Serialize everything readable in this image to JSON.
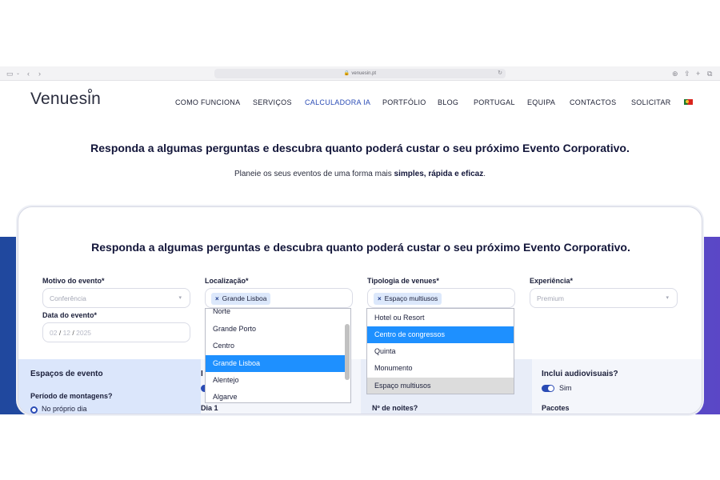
{
  "browser": {
    "url": "venuesin.pt"
  },
  "site": {
    "logo": "Venuesin",
    "nav": [
      {
        "label": "COMO FUNCIONA"
      },
      {
        "label": "SERVIÇOS"
      },
      {
        "label": "CALCULADORA IA"
      },
      {
        "label": "PORTFÓLIO"
      },
      {
        "label": "BLOG"
      },
      {
        "label": "PORTUGAL"
      },
      {
        "label": "EQUIPA"
      },
      {
        "label": "CONTACTOS"
      },
      {
        "label": "SOLICITAR"
      }
    ],
    "active_nav": "CALCULADORA IA"
  },
  "hero": {
    "headline": "Responda a algumas perguntas e descubra quanto poderá custar o seu próximo Evento Corporativo.",
    "sub_prefix": "Planeie os seus eventos de uma forma mais ",
    "sub_bold": "simples, rápida e eficaz",
    "sub_suffix": "."
  },
  "form": {
    "title": "Responda a algumas perguntas e descubra quanto poderá custar o seu próximo Evento Corporativo.",
    "motivo": {
      "label": "Motivo do evento*",
      "placeholder": "Conferência"
    },
    "data": {
      "label": "Data do evento*",
      "dd": "02",
      "mm": "12",
      "yyyy": "2025"
    },
    "localizacao": {
      "label": "Localização*",
      "chip": "Grande Lisboa",
      "options": [
        "Norte",
        "Grande Porto",
        "Centro",
        "Grande Lisboa",
        "Alentejo",
        "Algarve"
      ],
      "highlighted": "Grande Lisboa"
    },
    "tipologia": {
      "label": "Tipologia de venues*",
      "chip": "Espaço multiusos",
      "options": [
        "Hotel ou Resort",
        "Centro de congressos",
        "Quinta",
        "Monumento",
        "Espaço multiusos"
      ],
      "highlighted": "Centro de congressos",
      "chosen": "Espaço multiusos"
    },
    "experiencia": {
      "label": "Experiência*",
      "placeholder": "Premium"
    }
  },
  "lower": {
    "espacos": "Espaços de evento",
    "periodo": "Período de montagens?",
    "proprio_dia": "No próprio dia",
    "col2_partial": "I",
    "dia": "Dia 1",
    "noites": "Nº de noites?",
    "audiovisuais": "Inclui audiovisuais?",
    "sim": "Sim",
    "pacotes": "Pacotes"
  },
  "colors": {
    "accent": "#2a4bb5",
    "highlight": "#1e90ff",
    "band": "#2b56b4",
    "chip": "#dce8fb"
  }
}
